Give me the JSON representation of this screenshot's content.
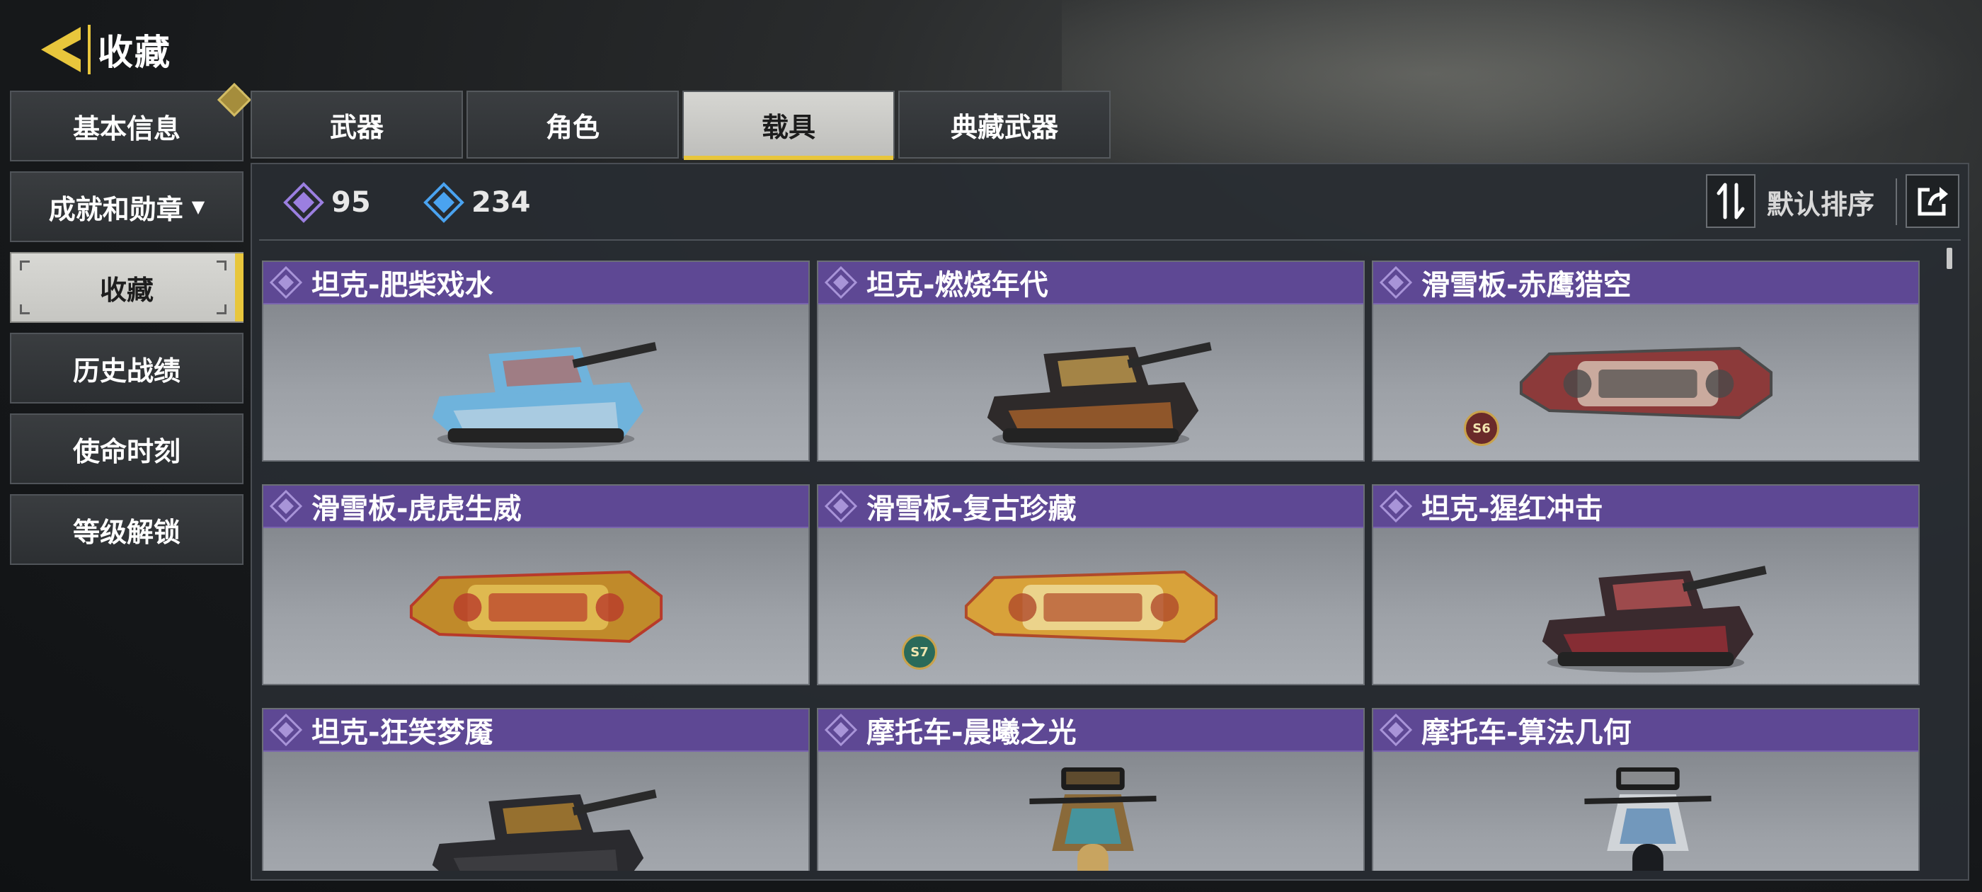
{
  "header": {
    "title": "收藏"
  },
  "sidebar": {
    "items": [
      {
        "label": "基本信息"
      },
      {
        "label": "成就和勋章"
      },
      {
        "label": "收藏"
      },
      {
        "label": "历史战绩"
      },
      {
        "label": "使命时刻"
      },
      {
        "label": "等级解锁"
      }
    ],
    "active_index": 2
  },
  "tabs": [
    {
      "label": "武器"
    },
    {
      "label": "角色"
    },
    {
      "label": "载具"
    },
    {
      "label": "典藏武器"
    }
  ],
  "active_tab": 2,
  "currencies": [
    {
      "icon": "purple-rarity-icon",
      "value": "95",
      "color": "#9b7fe0"
    },
    {
      "icon": "blue-rarity-icon",
      "value": "234",
      "color": "#4aa3f0"
    }
  ],
  "toolbar": {
    "sort_label": "默认排序"
  },
  "items": [
    {
      "name": "坦克-肥柴戏水",
      "kind": "tank",
      "palette": "blue"
    },
    {
      "name": "坦克-燃烧年代",
      "kind": "tank",
      "palette": "fire"
    },
    {
      "name": "滑雪板-赤鹰猎空",
      "kind": "board",
      "palette": "crimson",
      "season": "S6"
    },
    {
      "name": "滑雪板-虎虎生威",
      "kind": "board",
      "palette": "gold"
    },
    {
      "name": "滑雪板-复古珍藏",
      "kind": "board",
      "palette": "retro",
      "season": "S7"
    },
    {
      "name": "坦克-猩红冲击",
      "kind": "tank",
      "palette": "red"
    },
    {
      "name": "坦克-狂笑梦魇",
      "kind": "tank",
      "palette": "dark"
    },
    {
      "name": "摩托车-晨曦之光",
      "kind": "moto",
      "palette": "teal"
    },
    {
      "name": "摩托车-算法几何",
      "kind": "moto",
      "palette": "silver"
    }
  ],
  "colors": {
    "accent": "#e8c63c",
    "card_header": "#5e4894"
  }
}
